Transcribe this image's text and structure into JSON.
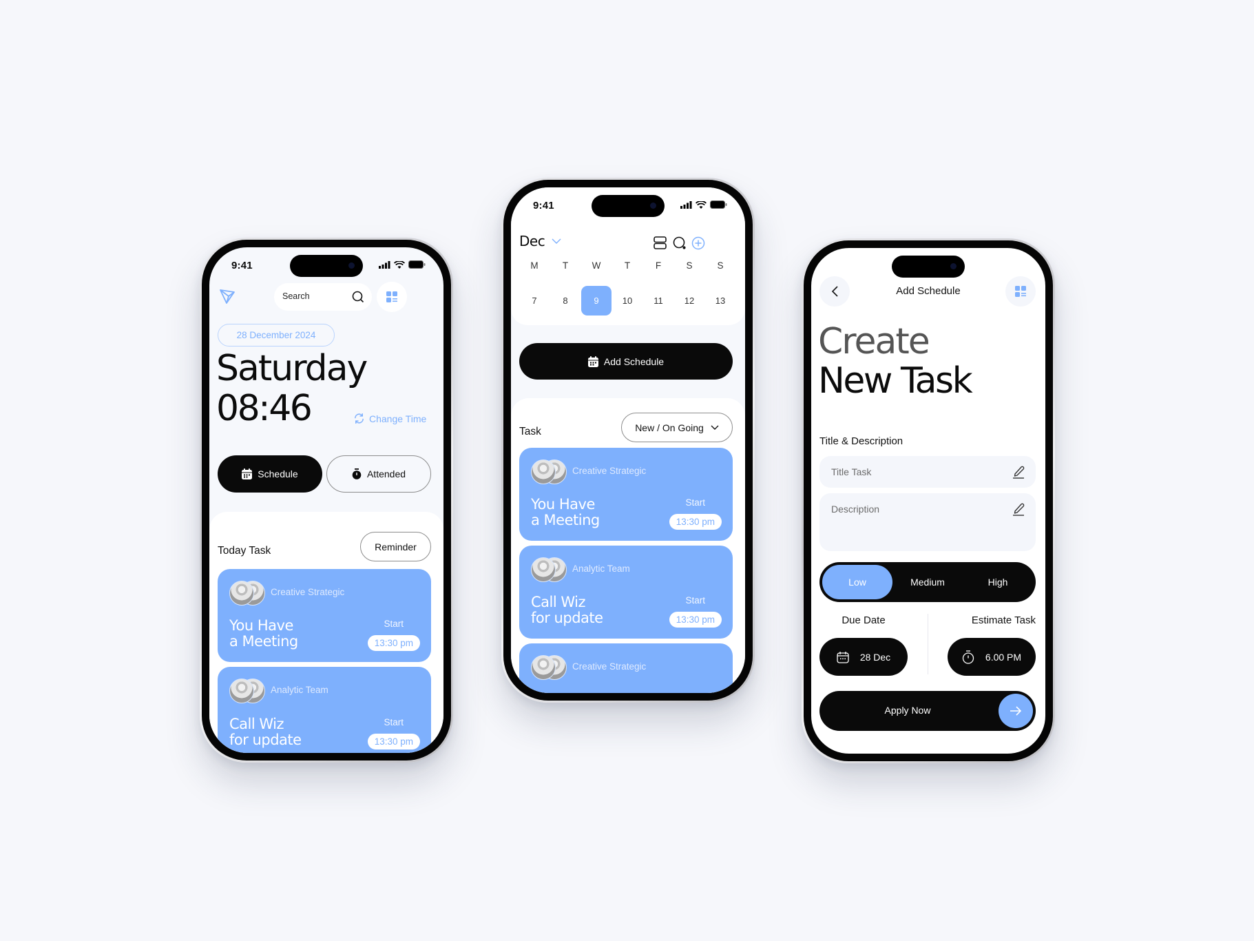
{
  "status_bar": {
    "time": "9:41"
  },
  "colors": {
    "accent": "#7eb0fd",
    "dark": "#0a0a0a",
    "background": "#f6f7fb"
  },
  "home_screen": {
    "logo_icon": "diamond-logo-icon",
    "search": {
      "placeholder": "Search",
      "icon": "search-icon"
    },
    "menu_icon": "grid-menu-icon",
    "date_badge": "28 December 2024",
    "day": "Saturday",
    "time": "08:46",
    "change_time_label": "Change Time",
    "schedule_button": "Schedule",
    "attended_button": "Attended",
    "section_title": "Today Task",
    "reminder_button": "Reminder",
    "tasks": [
      {
        "team": "Creative Strategic",
        "title_line1": "You Have",
        "title_line2": "a Meeting",
        "start_label": "Start",
        "time": "13:30 pm"
      },
      {
        "team": "Analytic Team",
        "title_line1": "Call Wiz",
        "title_line2": "for update",
        "start_label": "Start",
        "time": "13:30 pm"
      }
    ]
  },
  "calendar_screen": {
    "month": "Dec",
    "weekdays": [
      "M",
      "T",
      "W",
      "T",
      "F",
      "S",
      "S"
    ],
    "dates": [
      "7",
      "8",
      "9",
      "10",
      "11",
      "12",
      "13"
    ],
    "selected_date": "9",
    "add_schedule_button": "Add Schedule",
    "section_title": "Task",
    "filter": {
      "selected": "New / On Going"
    },
    "tasks": [
      {
        "team": "Creative Strategic",
        "title_line1": "You Have",
        "title_line2": "a Meeting",
        "start_label": "Start",
        "time": "13:30 pm"
      },
      {
        "team": "Analytic Team",
        "title_line1": "Call Wiz",
        "title_line2": "for update",
        "start_label": "Start",
        "time": "13:30 pm"
      },
      {
        "team": "Creative Strategic"
      }
    ]
  },
  "add_screen": {
    "header_title": "Add Schedule",
    "heading_line1": "Create",
    "heading_line2": "New Task",
    "section_label": "Title & Description",
    "title_field": {
      "placeholder": "Title Task"
    },
    "description_field": {
      "placeholder": "Description"
    },
    "priority": {
      "options": [
        "Low",
        "Medium",
        "High"
      ],
      "selected": "Low"
    },
    "due_date": {
      "label": "Due Date",
      "value": "28 Dec"
    },
    "estimate": {
      "label": "Estimate Task",
      "value": "6.00 PM"
    },
    "apply_button": "Apply Now"
  }
}
